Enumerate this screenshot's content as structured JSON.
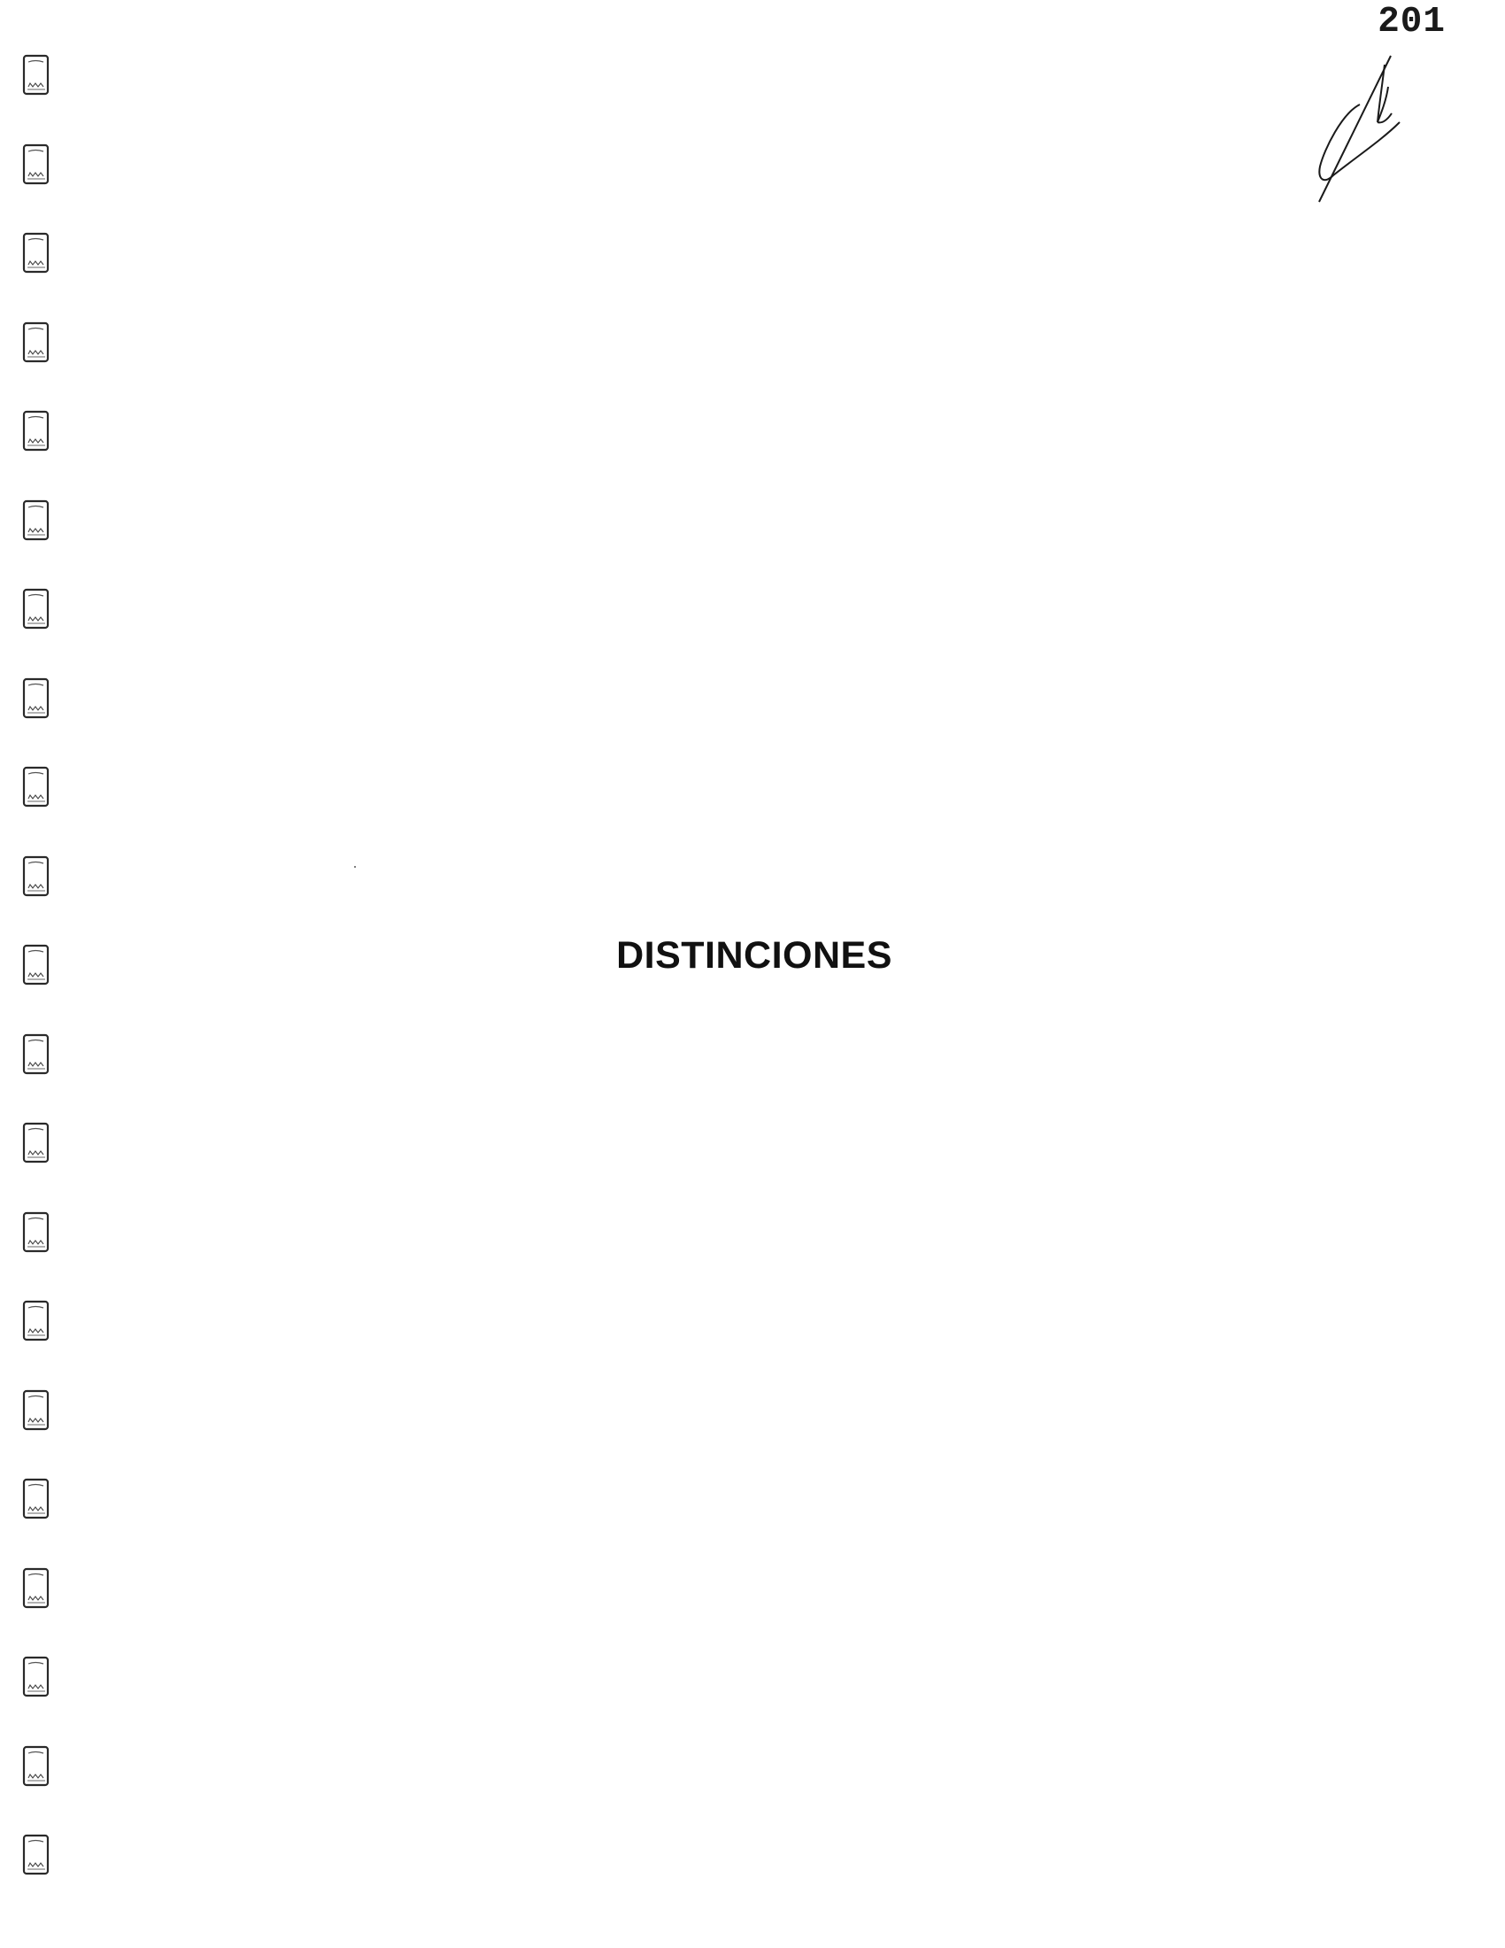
{
  "document": {
    "page_number": "201",
    "title": "DISTINCIONES",
    "binding_ring_count": 21,
    "signature": "handwritten-signature"
  },
  "colors": {
    "ink": "#111111",
    "paper": "#ffffff"
  }
}
